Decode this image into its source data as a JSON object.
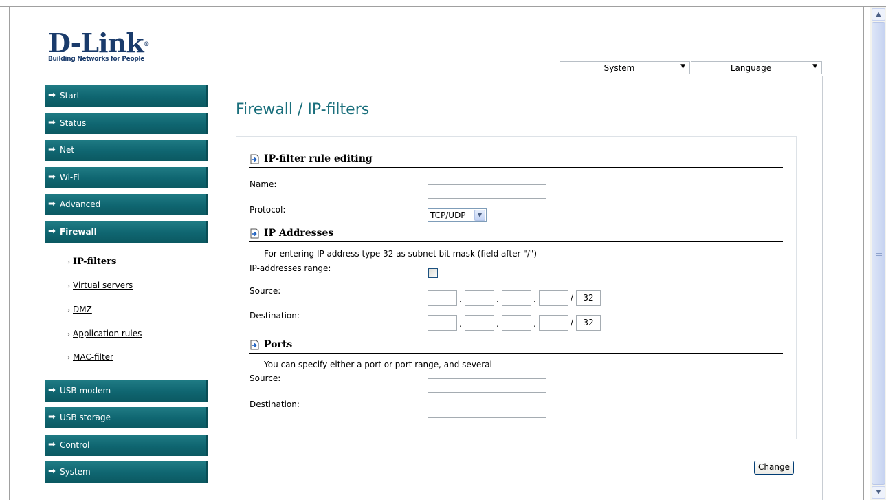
{
  "logo": {
    "brand": "D-Link",
    "registered": "®",
    "tagline": "Building Networks for People"
  },
  "topmenu": {
    "system": {
      "label": "System",
      "arrow": "▼"
    },
    "language": {
      "label": "Language",
      "arrow": "▼"
    }
  },
  "nav": {
    "arrow_glyph": "➡",
    "items": [
      {
        "label": "Start"
      },
      {
        "label": "Status"
      },
      {
        "label": "Net"
      },
      {
        "label": "Wi-Fi"
      },
      {
        "label": "Advanced"
      },
      {
        "label": "Firewall"
      },
      {
        "label": "USB modem"
      },
      {
        "label": "USB storage"
      },
      {
        "label": "Control"
      },
      {
        "label": "System"
      }
    ],
    "firewall_sub": [
      {
        "label": "IP-filters"
      },
      {
        "label": "Virtual servers"
      },
      {
        "label": "DMZ"
      },
      {
        "label": "Application rules"
      },
      {
        "label": "MAC-filter"
      }
    ],
    "sub_bullet": "›"
  },
  "page": {
    "title": "Firewall / IP-filters"
  },
  "form": {
    "section_rule": {
      "title": "IP-filter rule editing",
      "name_label": "Name:",
      "name_value": "",
      "protocol_label": "Protocol:",
      "protocol_value": "TCP/UDP",
      "protocol_arrow": "▼"
    },
    "section_ip": {
      "title": "IP Addresses",
      "note": "For entering IP address type 32 as subnet bit-mask (field after \"/\")",
      "range_label": "IP-addresses range:",
      "range_checked": false,
      "source_label": "Source:",
      "destination_label": "Destination:",
      "source_mask": "32",
      "destination_mask": "32",
      "dot": ".",
      "slash": "/"
    },
    "section_ports": {
      "title": "Ports",
      "note": "You can specify either a port or port range, and several",
      "source_label": "Source:",
      "destination_label": "Destination:",
      "source_value": "",
      "destination_value": ""
    },
    "change_label": "Change"
  },
  "scrollbar": {
    "up": "▲",
    "down": "▼"
  }
}
